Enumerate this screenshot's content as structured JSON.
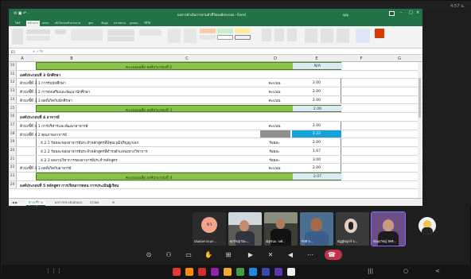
{
  "status_time": "4:57 น.",
  "excel": {
    "title": "ผลการดำเนินการตามตัวชี้วัดองค์ประกอบ - Excel",
    "user": "ญญ",
    "tabs": [
      "ไฟล์",
      "หน้าแรก",
      "แทรก",
      "เค้าโครงหน้ากระดาษ",
      "สูตร",
      "ข้อมูล",
      "ตรวจทาน",
      "มุมมอง",
      "วิธีใช้"
    ],
    "formula_ref": "E5",
    "columns": [
      "A",
      "B",
      "C",
      "D",
      "E",
      "F",
      "G"
    ],
    "rows": [
      {
        "n": "10",
        "type": "band",
        "label": "คะแนนเฉลี่ย องค์ประกอบที่ 2",
        "value": "N/A"
      },
      {
        "n": "11",
        "type": "header",
        "label": "องค์ประกอบที่ 3 นักศึกษา"
      },
      {
        "n": "12",
        "type": "item",
        "label": "ตัวบ่งชี้ที่ 3.1 การรับนักศึกษา",
        "d": "คะแนน",
        "e": "2.00"
      },
      {
        "n": "13",
        "type": "item",
        "label": "ตัวบ่งชี้ที่ 3.2 การส่งเสริมและพัฒนานักศึกษา",
        "d": "คะแนน",
        "e": "2.00"
      },
      {
        "n": "14",
        "type": "item",
        "label": "ตัวบ่งชี้ที่ 3.3 ผลที่เกิดกับนักศึกษา",
        "d": "คะแนน",
        "e": "2.00"
      },
      {
        "n": "15",
        "type": "band",
        "label": "คะแนนเฉลี่ย องค์ประกอบที่ 3",
        "value": "2.00"
      },
      {
        "n": "16",
        "type": "header",
        "label": "องค์ประกอบที่ 4 อาจารย์"
      },
      {
        "n": "17",
        "type": "item",
        "label": "ตัวบ่งชี้ที่ 4.1 การบริหารและพัฒนาอาจารย์",
        "d": "คะแนน",
        "e": "2.00"
      },
      {
        "n": "18",
        "type": "selected",
        "label": "ตัวบ่งชี้ที่ 4.2 คุณภาพอาจารย์",
        "d": "",
        "e": "2.22"
      },
      {
        "n": "19",
        "type": "sub",
        "label": "4.2.1 ร้อยละของอาจารย์ประจำหลักสูตรที่มีคุณวุฒิปริญญาเอก",
        "d": "ร้อยละ",
        "e": "2.00"
      },
      {
        "n": "20",
        "type": "sub",
        "label": "4.2.2 ร้อยละของอาจารย์ประจำหลักสูตรที่ดำรงตำแหน่งทางวิชาการ",
        "d": "ร้อยละ",
        "e": "1.67"
      },
      {
        "n": "21",
        "type": "sub",
        "label": "4.2.3 ผลงานวิชาการของอาจารย์ประจำหลักสูตร",
        "d": "ร้อยละ",
        "e": "3.00"
      },
      {
        "n": "22",
        "type": "item",
        "label": "ตัวบ่งชี้ที่ 4.3 ผลที่เกิดกับอาจารย์",
        "d": "คะแนน",
        "e": "2.00"
      },
      {
        "n": "23",
        "type": "band",
        "label": "คะแนนเฉลี่ย องค์ประกอบที่ 4",
        "value": "2.07"
      },
      {
        "n": "24",
        "type": "header",
        "label": "องค์ประกอบที่ 5 หลักสูตร การเรียนการสอน การประเมินผู้เรียน"
      }
    ],
    "sheet_tabs": [
      "ตัวบ่งชี้รวม",
      "ผลการประเมินตนเอง",
      "สรุปผล"
    ]
  },
  "presenter_label": "ณัฏฐ์ชญาร์ (ผู้นำเสนอ)",
  "participants": [
    {
      "caption": "ปณณพร ตะแก...",
      "initials": "จว",
      "kind": "avatar"
    },
    {
      "caption": "ศุภวิชญ์ ปิยะ...",
      "kind": "video"
    },
    {
      "caption": "ณัฐชนน วงศ์...",
      "kind": "video"
    },
    {
      "caption": "กิตติ จ...",
      "kind": "video"
    },
    {
      "caption": "ณัฏฐ์ชญาร์ จ...",
      "kind": "video"
    },
    {
      "caption": "ปัณณวิชญ์ อิทธิ...",
      "kind": "video"
    }
  ],
  "controls": [
    "timer-icon",
    "participants-icon",
    "chat-icon",
    "raise-hand-icon",
    "grid-icon",
    "camera-off-icon",
    "mic-off-icon",
    "speaker-icon",
    "more-icon",
    "leave-call-icon"
  ],
  "accent": "#217346"
}
